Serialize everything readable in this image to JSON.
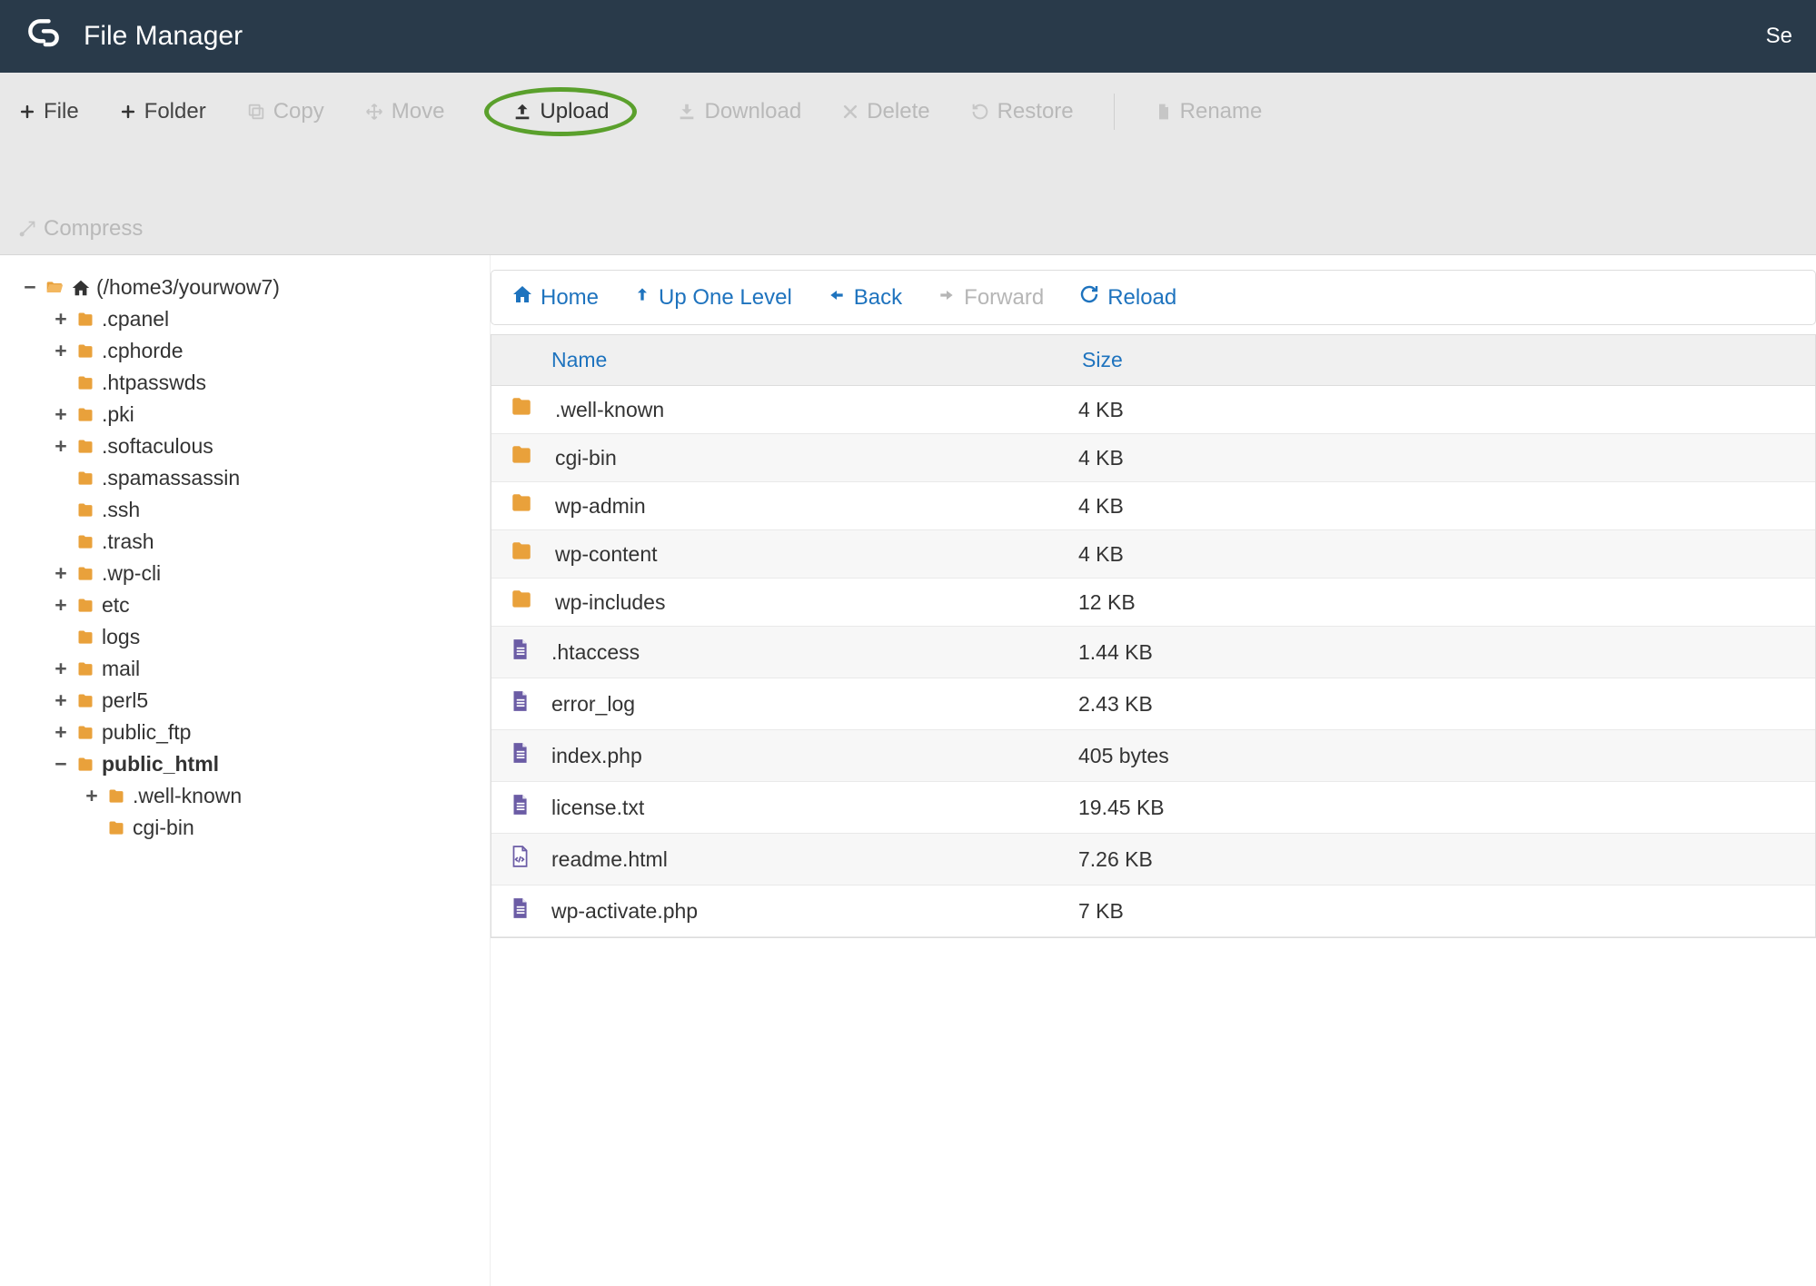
{
  "header": {
    "title": "File Manager",
    "right": "Se"
  },
  "toolbar": {
    "file": "File",
    "folder": "Folder",
    "copy": "Copy",
    "move": "Move",
    "upload": "Upload",
    "download": "Download",
    "delete": "Delete",
    "restore": "Restore",
    "rename": "Rename",
    "compress": "Compress"
  },
  "tree": {
    "root": "(/home3/yourwow7)",
    "items": [
      {
        "toggle": "+",
        "label": ".cpanel",
        "indent": 1
      },
      {
        "toggle": "+",
        "label": ".cphorde",
        "indent": 1
      },
      {
        "toggle": "",
        "label": ".htpasswds",
        "indent": 1
      },
      {
        "toggle": "+",
        "label": ".pki",
        "indent": 1
      },
      {
        "toggle": "+",
        "label": ".softaculous",
        "indent": 1
      },
      {
        "toggle": "",
        "label": ".spamassassin",
        "indent": 1
      },
      {
        "toggle": "",
        "label": ".ssh",
        "indent": 1
      },
      {
        "toggle": "",
        "label": ".trash",
        "indent": 1
      },
      {
        "toggle": "+",
        "label": ".wp-cli",
        "indent": 1
      },
      {
        "toggle": "+",
        "label": "etc",
        "indent": 1
      },
      {
        "toggle": "",
        "label": "logs",
        "indent": 1
      },
      {
        "toggle": "+",
        "label": "mail",
        "indent": 1
      },
      {
        "toggle": "+",
        "label": "perl5",
        "indent": 1
      },
      {
        "toggle": "+",
        "label": "public_ftp",
        "indent": 1
      },
      {
        "toggle": "−",
        "label": "public_html",
        "indent": 1,
        "bold": true
      },
      {
        "toggle": "+",
        "label": ".well-known",
        "indent": 2
      },
      {
        "toggle": "",
        "label": "cgi-bin",
        "indent": 2
      }
    ]
  },
  "nav": {
    "home": "Home",
    "up": "Up One Level",
    "back": "Back",
    "forward": "Forward",
    "reload": "Reload"
  },
  "table": {
    "headers": {
      "name": "Name",
      "size": "Size"
    },
    "rows": [
      {
        "type": "folder",
        "name": ".well-known",
        "size": "4 KB"
      },
      {
        "type": "folder",
        "name": "cgi-bin",
        "size": "4 KB"
      },
      {
        "type": "folder",
        "name": "wp-admin",
        "size": "4 KB"
      },
      {
        "type": "folder",
        "name": "wp-content",
        "size": "4 KB"
      },
      {
        "type": "folder",
        "name": "wp-includes",
        "size": "12 KB"
      },
      {
        "type": "file",
        "name": ".htaccess",
        "size": "1.44 KB"
      },
      {
        "type": "file",
        "name": "error_log",
        "size": "2.43 KB"
      },
      {
        "type": "file",
        "name": "index.php",
        "size": "405 bytes"
      },
      {
        "type": "file",
        "name": "license.txt",
        "size": "19.45 KB"
      },
      {
        "type": "html",
        "name": "readme.html",
        "size": "7.26 KB"
      },
      {
        "type": "file",
        "name": "wp-activate.php",
        "size": "7 KB"
      }
    ]
  }
}
